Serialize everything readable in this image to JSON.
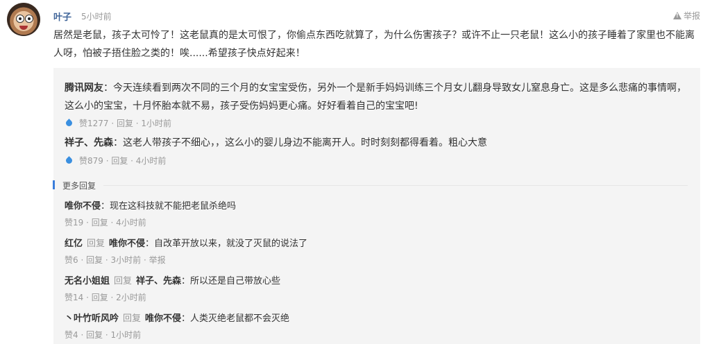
{
  "comment": {
    "author": "叶子",
    "time": "5小时前",
    "report": "举报",
    "text": "居然是老鼠，孩子太可怜了！这老鼠真的是太可恨了，你偷点东西吃就算了，为什么伤害孩子？或许不止一只老鼠！这么小的孩子睡着了家里也不能离人呀，怕被子捂住脸之类的！唉......希望孩子快点好起来！"
  },
  "quotes": [
    {
      "name": "腾讯网友",
      "text": "：今天连续看到两次不同的三个月的女宝宝受伤，另外一个是新手妈妈训练三个月女儿翻身导致女儿窒息身亡。这是多么悲痛的事情啊，这么小的宝宝，十月怀胎本就不易，孩子受伤妈妈更心痛。好好看着自己的宝宝吧!",
      "meta": "赞1277 · 回复 · 1小时前"
    },
    {
      "name": "祥子、先森",
      "text": "：这老人带孩子不细心，，这么小的婴儿身边不能离开人。时时刻刻都得看着。粗心大意",
      "meta": "赞879 · 回复 · 4小时前"
    }
  ],
  "more_label": "更多回复",
  "replies": [
    {
      "name": "唯你不侵",
      "reply_label": "",
      "target": "",
      "text": "：现在这科技就不能把老鼠杀绝吗",
      "meta": "赞19 · 回复 · 4小时前"
    },
    {
      "name": "红亿",
      "reply_label": "回复",
      "target": "唯你不侵",
      "text": "：自改革开放以来，就没了灭鼠的说法了",
      "meta": "赞6 · 回复 · 3小时前 · 举报"
    },
    {
      "name": "无名小姐姐",
      "reply_label": "回复",
      "target": "祥子、先森",
      "text": "：所以还是自己带放心些",
      "meta": "赞14 · 回复 · 2小时前"
    },
    {
      "name": "丶叶竹听风吟",
      "reply_label": "回复",
      "target": "唯你不侵",
      "text": "：人类灭绝老鼠都不会灭绝",
      "meta": "赞4 · 回复 · 1小时前"
    }
  ]
}
